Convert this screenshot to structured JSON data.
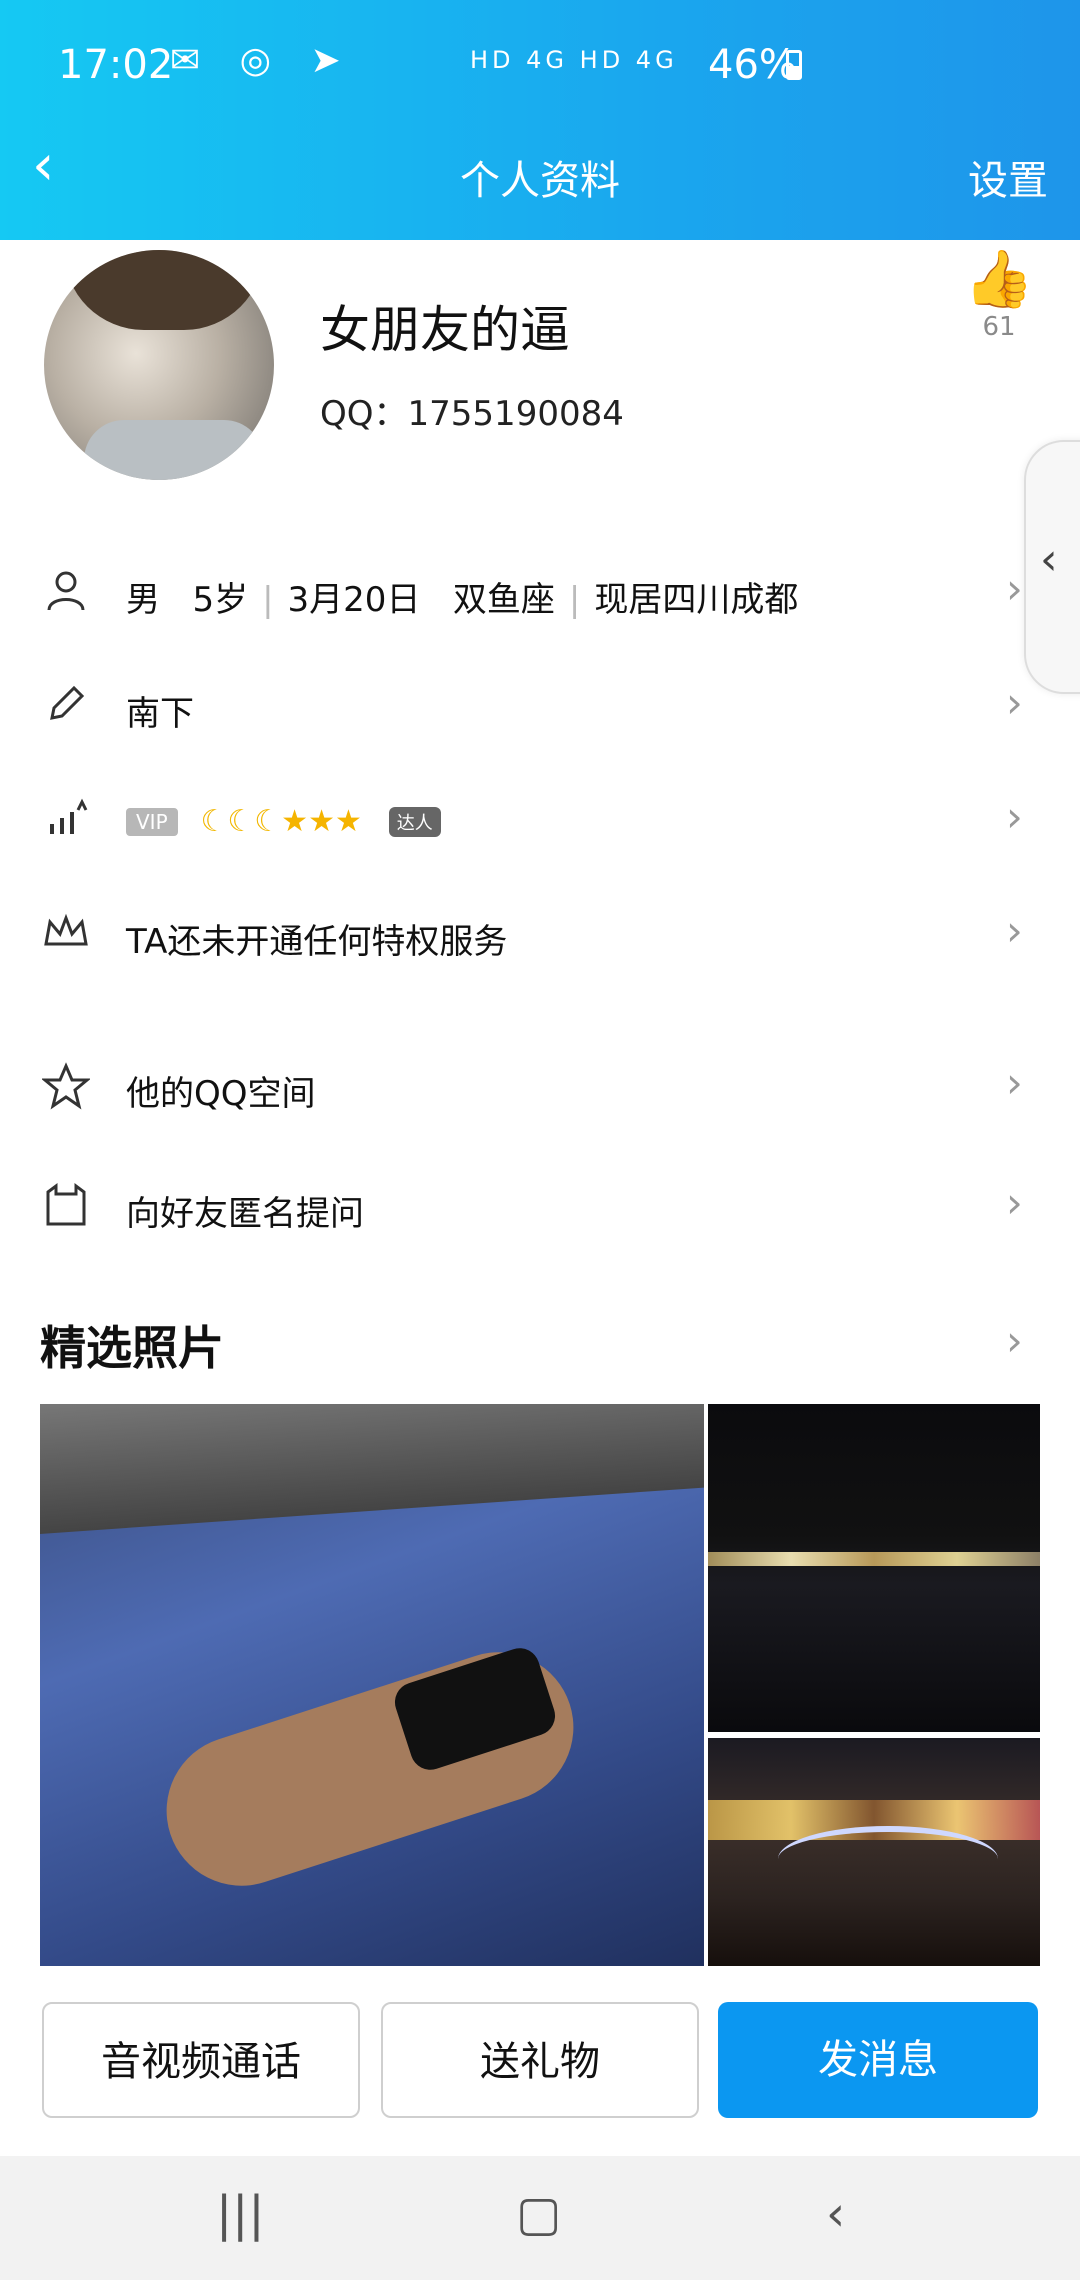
{
  "status_bar": {
    "time": "17:02",
    "network": "HD 4G HD 4G",
    "battery": "46%"
  },
  "nav": {
    "back_icon": "chevron-left-icon",
    "title": "个人资料",
    "settings": "设置"
  },
  "profile": {
    "nickname": "女朋友的逼",
    "qq_label": "QQ：",
    "qq_number": "1755190084",
    "likes": "61"
  },
  "info_rows": {
    "basic": {
      "gender": "男",
      "age": "5岁",
      "birthday": "3月20日",
      "zodiac": "双鱼座",
      "location": "现居四川成都"
    },
    "signature": "南下",
    "level": {
      "vip": "VIP",
      "badge": "达人"
    },
    "privilege": "TA还未开通任何特权服务",
    "qzone": "他的QQ空间",
    "anonymous": "向好友匿名提问"
  },
  "photos": {
    "title": "精选照片"
  },
  "actions": {
    "call": "音视频通话",
    "gift": "送礼物",
    "message": "发消息"
  },
  "colors": {
    "header_start": "#15c9f3",
    "header_end": "#1e95ea",
    "primary_button": "#0b97f1"
  }
}
